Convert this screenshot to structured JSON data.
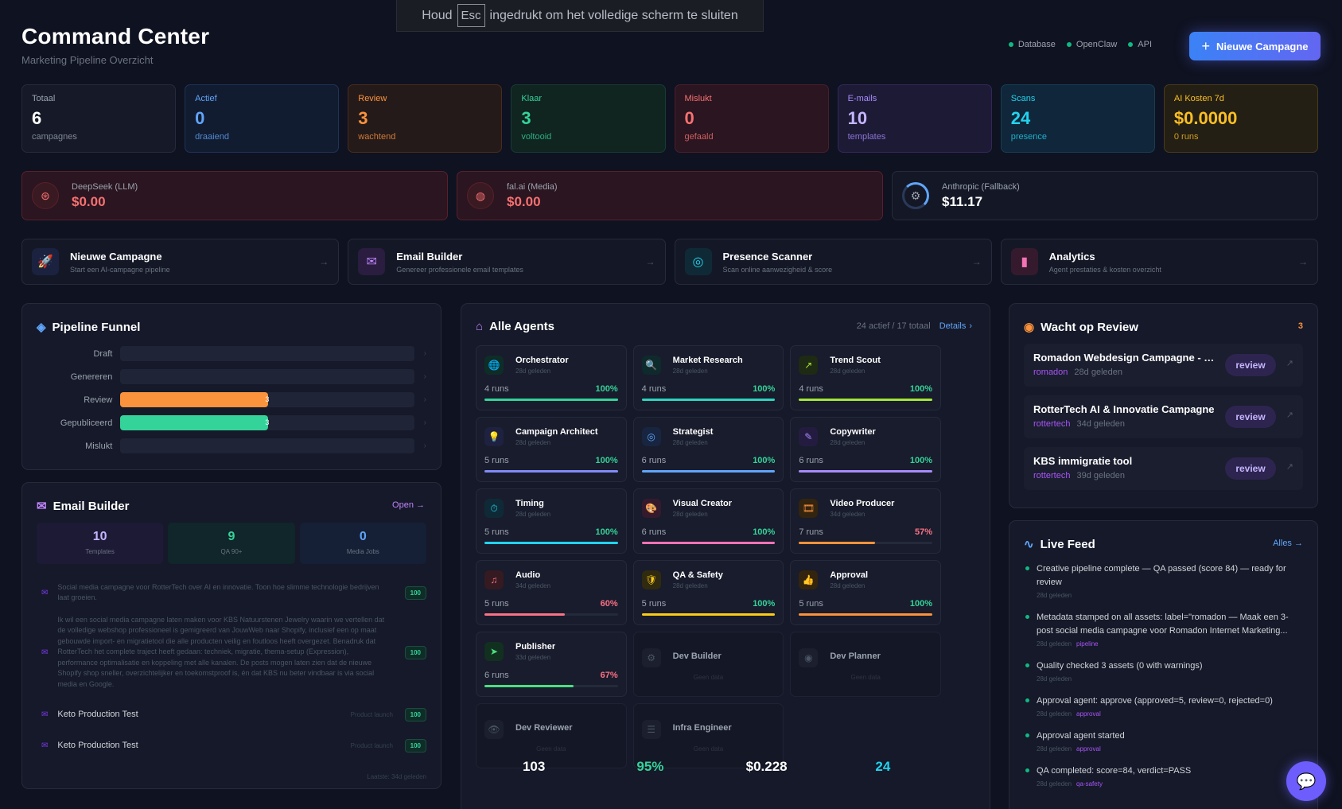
{
  "toast": {
    "pre": "Houd",
    "key": "Esc",
    "post": "ingedrukt om het volledige scherm te sluiten"
  },
  "header": {
    "title": "Command Center",
    "subtitle": "Marketing Pipeline Overzicht",
    "status": [
      "Database",
      "OpenClaw",
      "API"
    ],
    "new_button": "Nieuwe Campagne"
  },
  "stats": [
    {
      "label": "Totaal",
      "value": "6",
      "sub": "campagnes",
      "color": "#9ca3af",
      "vcolor": "#ffffff"
    },
    {
      "label": "Actief",
      "value": "0",
      "sub": "draaiend",
      "color": "#60a5fa",
      "vcolor": "#60a5fa"
    },
    {
      "label": "Review",
      "value": "3",
      "sub": "wachtend",
      "color": "#fb923c",
      "vcolor": "#fb923c"
    },
    {
      "label": "Klaar",
      "value": "3",
      "sub": "voltooid",
      "color": "#34d399",
      "vcolor": "#34d399"
    },
    {
      "label": "Mislukt",
      "value": "0",
      "sub": "gefaald",
      "color": "#f87171",
      "vcolor": "#f87171"
    },
    {
      "label": "E-mails",
      "value": "10",
      "sub": "templates",
      "color": "#a78bfa",
      "vcolor": "#c4b5fd"
    },
    {
      "label": "Scans",
      "value": "24",
      "sub": "presence",
      "color": "#22d3ee",
      "vcolor": "#22d3ee"
    },
    {
      "label": "AI Kosten 7d",
      "value": "$0.0000",
      "sub": "0 runs",
      "color": "#fbbf24",
      "vcolor": "#fbbf24"
    }
  ],
  "costs": [
    {
      "label": "DeepSeek (LLM)",
      "value": "$0.00"
    },
    {
      "label": "fal.ai (Media)",
      "value": "$0.00"
    },
    {
      "label": "Anthropic (Fallback)",
      "value": "$11.17"
    }
  ],
  "actions": [
    {
      "title": "Nieuwe Campagne",
      "desc": "Start een AI-campagne pipeline"
    },
    {
      "title": "Email Builder",
      "desc": "Genereer professionele email templates"
    },
    {
      "title": "Presence Scanner",
      "desc": "Scan online aanwezigheid & score"
    },
    {
      "title": "Analytics",
      "desc": "Agent prestaties & kosten overzicht"
    }
  ],
  "funnel": {
    "title": "Pipeline Funnel",
    "rows": [
      {
        "label": "Draft",
        "value": "0",
        "fraction": 0
      },
      {
        "label": "Genereren",
        "value": "0",
        "fraction": 0
      },
      {
        "label": "Review",
        "value": "3",
        "fraction": 0.5
      },
      {
        "label": "Gepubliceerd",
        "value": "3",
        "fraction": 0.5
      },
      {
        "label": "Mislukt",
        "value": "0",
        "fraction": 0
      }
    ]
  },
  "email_builder": {
    "title": "Email Builder",
    "open": "Open →",
    "stats": [
      {
        "value": "10",
        "label": "Templates"
      },
      {
        "value": "9",
        "label": "QA 90+"
      },
      {
        "value": "0",
        "label": "Media Jobs"
      }
    ],
    "items": [
      {
        "text": "Social media campagne voor RotterTech over AI en innovatie. Toon hoe slimme technologie bedrijven laat groeien.",
        "tag": "",
        "score": "100"
      },
      {
        "text": "Ik wil een social media campagne laten maken voor KBS Natuurstenen Jewelry waarin we vertellen dat de volledige webshop professioneel is gemigreerd van JouwWeb naar Shopify, inclusief een op maat gebouwde import- en migratietool die alle producten veilig en foutloos heeft overgezet. Benadruk dat RotterTech het complete traject heeft gedaan: techniek, migratie, thema-setup (Expression), performance optimalisatie en koppeling met alle kanalen. De posts mogen laten zien dat de nieuwe Shopify shop sneller, overzichtelijker en toekomstproof is, én dat KBS nu beter vindbaar is via social media en Google.",
        "tag": "",
        "score": "100"
      },
      {
        "text": "Keto Production Test",
        "tag": "Product launch",
        "score": "100"
      },
      {
        "text": "Keto Production Test",
        "tag": "Product launch",
        "score": "100"
      }
    ],
    "footer": "Laatste: 34d geleden"
  },
  "agents": {
    "title": "Alle Agents",
    "meta": "24 actief / 17 totaal",
    "details": "Details",
    "list": [
      {
        "name": "Orchestrator",
        "ago": "28d geleden",
        "runs": "4 runs",
        "pct": "100%",
        "fraction": 1.0,
        "color": "#34d399",
        "bg": "#0f2d27",
        "icon": "🌐"
      },
      {
        "name": "Market Research",
        "ago": "28d geleden",
        "runs": "4 runs",
        "pct": "100%",
        "fraction": 1.0,
        "color": "#2dd4bf",
        "bg": "#0f2a2c",
        "icon": "🔍"
      },
      {
        "name": "Trend Scout",
        "ago": "28d geleden",
        "runs": "4 runs",
        "pct": "100%",
        "fraction": 1.0,
        "color": "#a3e635",
        "bg": "#1e2a14",
        "icon": "↗"
      },
      {
        "name": "Campaign Architect",
        "ago": "28d geleden",
        "runs": "5 runs",
        "pct": "100%",
        "fraction": 1.0,
        "color": "#818cf8",
        "bg": "#1e2140",
        "icon": "💡"
      },
      {
        "name": "Strategist",
        "ago": "28d geleden",
        "runs": "6 runs",
        "pct": "100%",
        "fraction": 1.0,
        "color": "#60a5fa",
        "bg": "#172540",
        "icon": "◎"
      },
      {
        "name": "Copywriter",
        "ago": "28d geleden",
        "runs": "6 runs",
        "pct": "100%",
        "fraction": 1.0,
        "color": "#a78bfa",
        "bg": "#241c40",
        "icon": "✎"
      },
      {
        "name": "Timing",
        "ago": "28d geleden",
        "runs": "5 runs",
        "pct": "100%",
        "fraction": 1.0,
        "color": "#22d3ee",
        "bg": "#0f2a36",
        "icon": "⏱"
      },
      {
        "name": "Visual Creator",
        "ago": "28d geleden",
        "runs": "6 runs",
        "pct": "100%",
        "fraction": 1.0,
        "color": "#f472b6",
        "bg": "#351a2e",
        "icon": "🎨"
      },
      {
        "name": "Video Producer",
        "ago": "34d geleden",
        "runs": "7 runs",
        "pct": "57%",
        "fraction": 0.57,
        "color": "#fb923c",
        "bg": "#33240f",
        "icon": "🎞"
      },
      {
        "name": "Audio",
        "ago": "34d geleden",
        "runs": "5 runs",
        "pct": "60%",
        "fraction": 0.6,
        "color": "#fb7185",
        "bg": "#351a22",
        "icon": "♫"
      },
      {
        "name": "QA & Safety",
        "ago": "28d geleden",
        "runs": "5 runs",
        "pct": "100%",
        "fraction": 1.0,
        "color": "#facc15",
        "bg": "#302a10",
        "icon": "🛡"
      },
      {
        "name": "Approval",
        "ago": "28d geleden",
        "runs": "5 runs",
        "pct": "100%",
        "fraction": 1.0,
        "color": "#fb923c",
        "bg": "#33240f",
        "icon": "👍"
      },
      {
        "name": "Publisher",
        "ago": "33d geleden",
        "runs": "6 runs",
        "pct": "67%",
        "fraction": 0.67,
        "color": "#4ade80",
        "bg": "#12301f",
        "icon": "➤"
      },
      {
        "name": "Dev Builder",
        "empty": "Geen data",
        "icon": "⚙"
      },
      {
        "name": "Dev Planner",
        "empty": "Geen data",
        "icon": "◉"
      },
      {
        "name": "Dev Reviewer",
        "empty": "Geen data",
        "icon": "👁"
      },
      {
        "name": "Infra Engineer",
        "empty": "Geen data",
        "icon": "☰"
      }
    ],
    "summary": [
      {
        "value": "103",
        "color": "#ffffff"
      },
      {
        "value": "95%",
        "color": "#34d399"
      },
      {
        "value": "$0.228",
        "color": "#ffffff"
      },
      {
        "value": "24",
        "color": "#22d3ee"
      }
    ]
  },
  "review": {
    "title": "Wacht op Review",
    "count": "3",
    "button": "review",
    "items": [
      {
        "title": "Romadon Webdesign Campagne - T...",
        "org": "romadon",
        "ago": "28d geleden"
      },
      {
        "title": "RotterTech AI & Innovatie Campagne",
        "org": "rottertech",
        "ago": "34d geleden"
      },
      {
        "title": "KBS immigratie tool",
        "org": "rottertech",
        "ago": "39d geleden"
      }
    ]
  },
  "feed": {
    "title": "Live Feed",
    "all": "Alles →",
    "items": [
      {
        "text": "Creative pipeline complete — QA passed (score 84) — ready for review",
        "ago": "28d geleden",
        "tag": ""
      },
      {
        "text": "Metadata stamped on all assets: label=\"romadon — Maak een 3-post social media campagne voor Romadon Internet Marketing...",
        "ago": "28d geleden",
        "tag": "pipeline"
      },
      {
        "text": "Quality checked 3 assets (0 with warnings)",
        "ago": "28d geleden",
        "tag": ""
      },
      {
        "text": "Approval agent: approve (approved=5, review=0, rejected=0)",
        "ago": "28d geleden",
        "tag": "approval"
      },
      {
        "text": "Approval agent started",
        "ago": "28d geleden",
        "tag": "approval"
      },
      {
        "text": "QA completed: score=84, verdict=PASS",
        "ago": "28d geleden",
        "tag": "qa-safety"
      }
    ]
  }
}
